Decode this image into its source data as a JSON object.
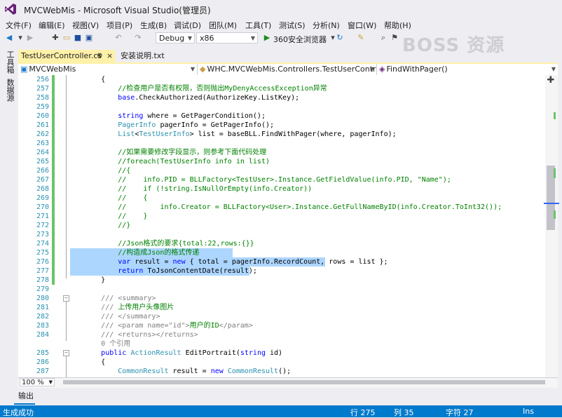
{
  "window": {
    "title": "MVCWebMis - Microsoft Visual Studio(管理员)",
    "watermark": "BOSS 资源"
  },
  "menu": [
    "文件(F)",
    "编辑(E)",
    "视图(V)",
    "项目(P)",
    "生成(B)",
    "调试(D)",
    "团队(M)",
    "工具(T)",
    "测试(S)",
    "分析(N)",
    "窗口(W)",
    "帮助(H)"
  ],
  "toolbar": {
    "config": "Debug",
    "platform": "x86",
    "browser": "360安全浏览器"
  },
  "left_tabs": [
    "工具箱",
    "数据源"
  ],
  "tabs": [
    {
      "label": "TestUserController.cs",
      "pin": "⊕",
      "close": "×"
    },
    {
      "label": "安装说明.txt"
    }
  ],
  "navbar": {
    "project": "MVCWebMis",
    "class": "WHC.MVCWebMis.Controllers.TestUserControlle",
    "member": "FindWithPager()"
  },
  "editor": {
    "lines": [
      {
        "n": "256",
        "t": "        {"
      },
      {
        "n": "257",
        "t": "            //检查用户是否有权限，否则抛出MyDenyAccessException异常"
      },
      {
        "n": "258",
        "t": "            base.CheckAuthorized(AuthorizeKey.ListKey);"
      },
      {
        "n": "259",
        "t": ""
      },
      {
        "n": "260",
        "t": "            string where = GetPagerCondition();"
      },
      {
        "n": "261",
        "t": "            PagerInfo pagerInfo = GetPagerInfo();"
      },
      {
        "n": "262",
        "t": "            List<TestUserInfo> list = baseBLL.FindWithPager(where, pagerInfo);"
      },
      {
        "n": "263",
        "t": ""
      },
      {
        "n": "264",
        "t": "            //如果需要修改字段显示，则参考下面代码处理"
      },
      {
        "n": "265",
        "t": "            //foreach(TestUserInfo info in list)"
      },
      {
        "n": "266",
        "t": "            //{"
      },
      {
        "n": "267",
        "t": "            //    info.PID = BLLFactory<TestUser>.Instance.GetFieldValue(info.PID, \"Name\");"
      },
      {
        "n": "268",
        "t": "            //    if (!string.IsNullOrEmpty(info.Creator))"
      },
      {
        "n": "269",
        "t": "            //    {"
      },
      {
        "n": "270",
        "t": "            //        info.Creator = BLLFactory<User>.Instance.GetFullNameByID(info.Creator.ToInt32());"
      },
      {
        "n": "271",
        "t": "            //    }"
      },
      {
        "n": "272",
        "t": "            //}"
      },
      {
        "n": "273",
        "t": ""
      },
      {
        "n": "274",
        "t": "            //Json格式的要求{total:22,rows:{}}"
      },
      {
        "n": "275",
        "t": "            //构造成Json的格式传递"
      },
      {
        "n": "276",
        "t": "            var result = new { total = pagerInfo.RecordCount, rows = list };"
      },
      {
        "n": "277",
        "t": "            return ToJsonContentDate(result);"
      },
      {
        "n": "278",
        "t": "        }"
      },
      {
        "n": "279",
        "t": ""
      },
      {
        "n": "280",
        "t": "        /// <summary>"
      },
      {
        "n": "281",
        "t": "        /// 上传用户头像图片"
      },
      {
        "n": "282",
        "t": "        /// </summary>"
      },
      {
        "n": "283",
        "t": "        /// <param name=\"id\">用户的ID</param>"
      },
      {
        "n": "284",
        "t": "        /// <returns></returns>"
      },
      {
        "n": "",
        "t": "        0 个引用"
      },
      {
        "n": "285",
        "t": "        public ActionResult EditPortrait(string id)"
      },
      {
        "n": "286",
        "t": "        {"
      },
      {
        "n": "287",
        "t": "            CommonResult result = new CommonResult();"
      }
    ],
    "zoom": "100 %"
  },
  "output_tab": "输出",
  "status": {
    "message": "生成成功",
    "row": "行 275",
    "col": "列 35",
    "char": "字符 27",
    "mode": "Ins"
  }
}
